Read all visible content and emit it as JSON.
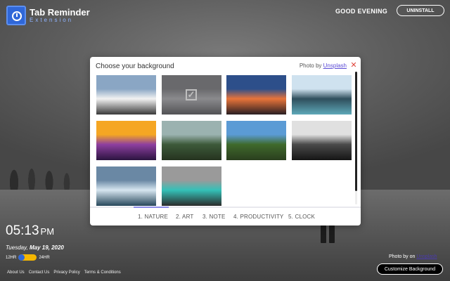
{
  "header": {
    "logo_title": "Tab Reminder",
    "logo_subtitle": "Extension",
    "greeting": "GOOD EVENING",
    "uninstall_label": "UNINSTALL"
  },
  "modal": {
    "title": "Choose your background",
    "credit_prefix": "Photo by",
    "credit_link": "Unsplash",
    "close_icon": "close-icon",
    "selected_index": 1,
    "thumbnails": [
      {
        "name": "mountain-road",
        "colors": [
          "#8aa6c4",
          "#f2f2f2",
          "#3a3a3a"
        ]
      },
      {
        "name": "snowy-field",
        "colors": [
          "#8c8c90",
          "#b8b8bc",
          "#6e6e72"
        ]
      },
      {
        "name": "sunset-snow",
        "colors": [
          "#2d4f8a",
          "#e8743a",
          "#2a1e22"
        ]
      },
      {
        "name": "lake-forest",
        "colors": [
          "#cfe2ef",
          "#2f4e5c",
          "#5ea8b8"
        ]
      },
      {
        "name": "lavender-field",
        "colors": [
          "#f5a623",
          "#8e3fa0",
          "#2b1440"
        ]
      },
      {
        "name": "river-valley",
        "colors": [
          "#9bb2b0",
          "#3d5a3a",
          "#25331f"
        ]
      },
      {
        "name": "tree-sun",
        "colors": [
          "#5b9bd5",
          "#3f6a2c",
          "#2a3e1e"
        ]
      },
      {
        "name": "forest-light",
        "colors": [
          "#e0e0e0",
          "#4a4a4a",
          "#151515"
        ]
      },
      {
        "name": "fjord",
        "colors": [
          "#6a88a4",
          "#d7e6f0",
          "#27475b"
        ]
      },
      {
        "name": "turquoise-lake",
        "colors": [
          "#9a9a9a",
          "#34c1b8",
          "#2b2b2b"
        ]
      }
    ],
    "tabs": [
      {
        "label": "1. NATURE"
      },
      {
        "label": "2. ART"
      },
      {
        "label": "3. NOTE"
      },
      {
        "label": "4. PRODUCTIVITY"
      },
      {
        "label": "5. CLOCK"
      }
    ]
  },
  "clock": {
    "time": "05:13",
    "ampm": "PM",
    "weekday": "Tuesday,",
    "date": "May 19, 2020",
    "fmt_12": "12HR",
    "fmt_24": "24HR"
  },
  "footer": {
    "links": [
      "About Us",
      "Contact Us",
      "Privacy Policy",
      "Terms & Conditions"
    ]
  },
  "photo": {
    "credit_prefix": "Photo by on",
    "credit_link": "Unsplash",
    "customize_label": "Customize Background"
  },
  "colors": {
    "accent_blue": "#2f67d8",
    "toggle_yellow": "#f5b700",
    "close_red": "#e0443a",
    "tab_indicator": "#8d8de8"
  }
}
